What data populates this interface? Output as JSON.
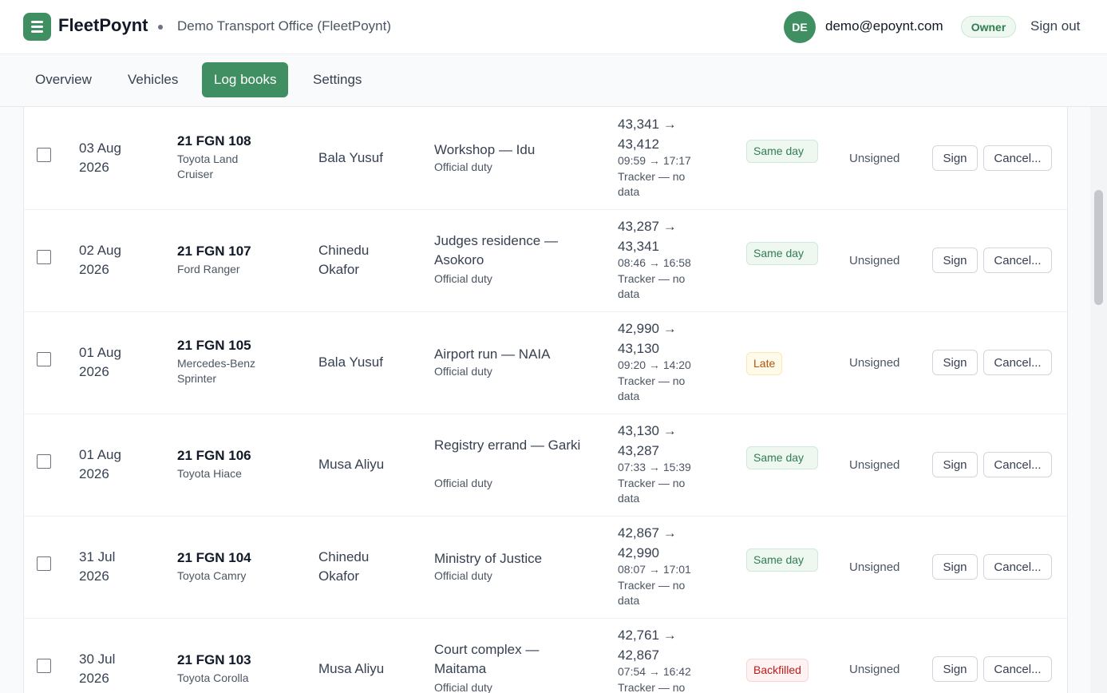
{
  "header": {
    "brand": "FleetPoynt",
    "organization": "Demo Transport Office (FleetPoynt)",
    "user_initials": "DE",
    "user_email": "demo@epoynt.com",
    "role_badge": "Owner",
    "sign_out": "Sign out",
    "brand_color": "#3f8f62"
  },
  "nav": {
    "tabs": [
      {
        "label": "Overview",
        "active": false
      },
      {
        "label": "Vehicles",
        "active": false
      },
      {
        "label": "Log books",
        "active": true
      },
      {
        "label": "Settings",
        "active": false
      }
    ]
  },
  "table": {
    "rows": [
      {
        "date_line1": "03 Aug",
        "date_line2": "2026",
        "plate": "21 FGN 108",
        "model": "Toyota Land Cruiser",
        "driver": "Bala Yusuf",
        "destination": "Workshop — Idu",
        "purpose": "Official duty",
        "odo_start": "43,341 →",
        "odo_end": "43,412",
        "times": "09:59 → 17:17",
        "tracker": "Tracker — no data",
        "timing": "Same day",
        "timing_style": "green",
        "status": "Unsigned",
        "sign_label": "Sign",
        "cancel_label": "Cancel..."
      },
      {
        "date_line1": "02 Aug",
        "date_line2": "2026",
        "plate": "21 FGN 107",
        "model": "Ford Ranger",
        "driver": "Chinedu Okafor",
        "destination": "Judges residence — Asokoro",
        "purpose": "Official duty",
        "odo_start": "43,287 →",
        "odo_end": "43,341",
        "times": "08:46 → 16:58",
        "tracker": "Tracker — no data",
        "timing": "Same day",
        "timing_style": "green",
        "status": "Unsigned",
        "sign_label": "Sign",
        "cancel_label": "Cancel..."
      },
      {
        "date_line1": "01 Aug",
        "date_line2": "2026",
        "plate": "21 FGN 105",
        "model": "Mercedes-Benz Sprinter",
        "driver": "Bala Yusuf",
        "destination": "Airport run — NAIA",
        "purpose": "Official duty",
        "odo_start": "42,990 →",
        "odo_end": "43,130",
        "times": "09:20 → 14:20",
        "tracker": "Tracker — no data",
        "timing": "Late",
        "timing_style": "amber",
        "status": "Unsigned",
        "sign_label": "Sign",
        "cancel_label": "Cancel..."
      },
      {
        "date_line1": "01 Aug",
        "date_line2": "2026",
        "plate": "21 FGN 106",
        "model": "Toyota Hiace",
        "driver": "Musa Aliyu",
        "destination": "Registry errand — Garki",
        "purpose": "Official duty",
        "odo_start": "43,130 →",
        "odo_end": "43,287",
        "times": "07:33 → 15:39",
        "tracker": "Tracker — no data",
        "timing": "Same day",
        "timing_style": "green",
        "status": "Unsigned",
        "sign_label": "Sign",
        "cancel_label": "Cancel..."
      },
      {
        "date_line1": "31 Jul",
        "date_line2": "2026",
        "plate": "21 FGN 104",
        "model": "Toyota Camry",
        "driver": "Chinedu Okafor",
        "destination": "Ministry of Justice",
        "purpose": "Official duty",
        "odo_start": "42,867 →",
        "odo_end": "42,990",
        "times": "08:07 → 17:01",
        "tracker": "Tracker — no data",
        "timing": "Same day",
        "timing_style": "green",
        "status": "Unsigned",
        "sign_label": "Sign",
        "cancel_label": "Cancel..."
      },
      {
        "date_line1": "30 Jul",
        "date_line2": "2026",
        "plate": "21 FGN 103",
        "model": "Toyota Corolla",
        "driver": "Musa Aliyu",
        "destination": "Court complex — Maitama",
        "purpose": "Official duty",
        "odo_start": "42,761 →",
        "odo_end": "42,867",
        "times": "07:54 → 16:42",
        "tracker": "Tracker — no data",
        "timing": "Backfilled",
        "timing_style": "red",
        "status": "Unsigned",
        "sign_label": "Sign",
        "cancel_label": "Cancel..."
      }
    ]
  }
}
